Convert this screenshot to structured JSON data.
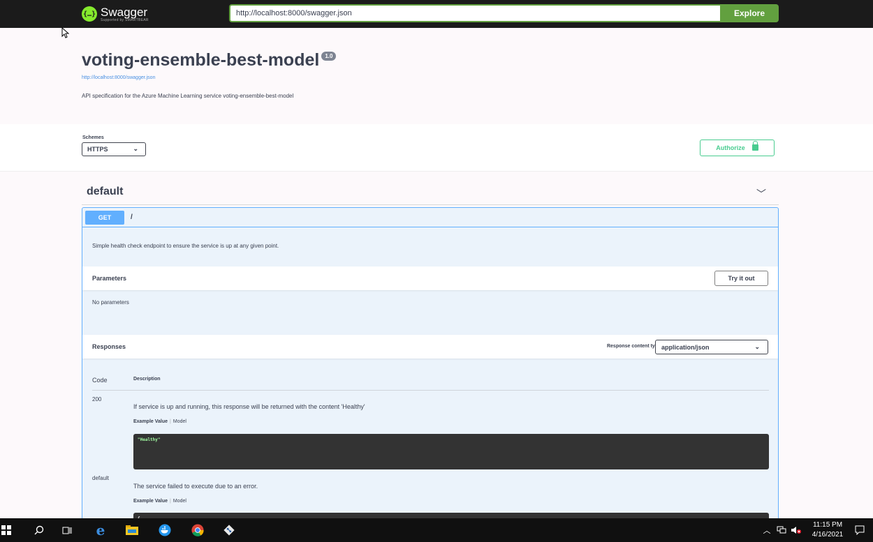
{
  "topbar": {
    "logo_name": "Swagger",
    "logo_sub": "Supported by SMARTBEAR",
    "logo_icon": "swagger-braces-icon",
    "url_value": "http://localhost:8000/swagger.json",
    "explore_label": "Explore"
  },
  "info": {
    "title": "voting-ensemble-best-model",
    "version": "1.0",
    "spec_link": "http://localhost:8000/swagger.json",
    "description": "API specification for the Azure Machine Learning service voting-ensemble-best-model"
  },
  "schemes": {
    "label": "Schemes",
    "selected": "HTTPS",
    "authorize_label": "Authorize"
  },
  "tag": {
    "name": "default"
  },
  "operation": {
    "method": "GET",
    "path": "/",
    "description": "Simple health check endpoint to ensure the service is up at any given point.",
    "parameters_label": "Parameters",
    "try_it_label": "Try it out",
    "no_parameters": "No parameters",
    "responses_label": "Responses",
    "response_content_type_label": "Response content type",
    "response_content_type": "application/json",
    "table_headers": {
      "code": "Code",
      "description": "Description"
    },
    "responses": [
      {
        "code": "200",
        "description": "If service is up and running, this response will be returned with the content 'Healthy'",
        "example_tab": "Example Value",
        "model_tab": "Model",
        "example": "\"Healthy\""
      },
      {
        "code": "default",
        "description": "The service failed to execute due to an error.",
        "example_tab": "Example Value",
        "model_tab": "Model",
        "example": "{"
      }
    ]
  },
  "taskbar": {
    "time": "11:15 PM",
    "date": "4/16/2021"
  },
  "colors": {
    "get": "#61affe",
    "explore": "#62a03f",
    "authorize": "#49cc90"
  }
}
